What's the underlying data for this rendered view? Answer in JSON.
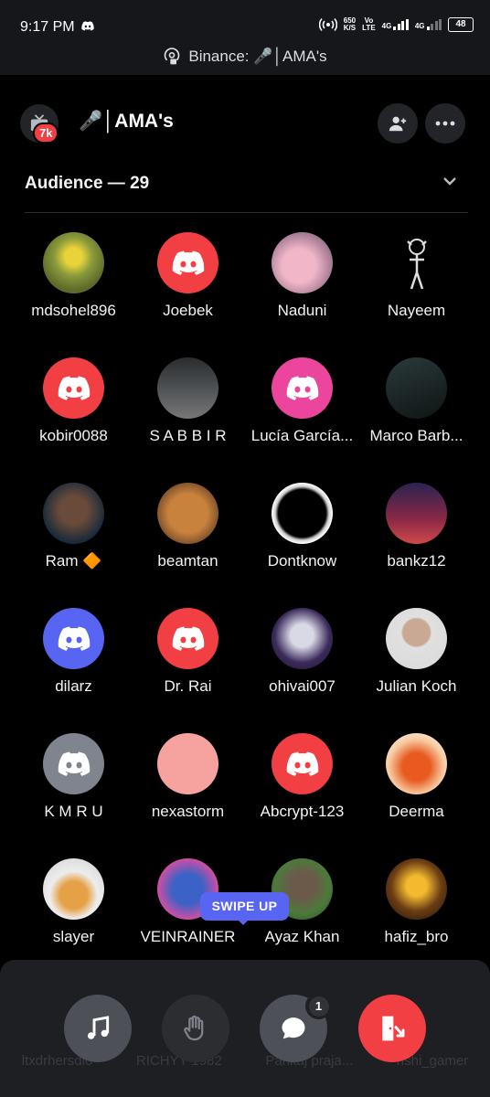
{
  "status_bar": {
    "time": "9:17 PM",
    "net_speed": "650",
    "net_unit": "K/S",
    "vo": "Vo",
    "lte": "LTE",
    "network1": "4G",
    "network2": "4G",
    "battery": "48",
    "banner_text": "Binance: 🎤│AMA's"
  },
  "header": {
    "badge": "7k",
    "title": "🎤│AMA's"
  },
  "audience": {
    "title": "Audience — 29",
    "members": [
      {
        "name": "mdsohel896",
        "avatar": "photo-flower"
      },
      {
        "name": "Joebek",
        "avatar": "discord-default-red"
      },
      {
        "name": "Naduni",
        "avatar": "photo-pink-flower"
      },
      {
        "name": "Nayeem",
        "avatar": "photo-figure"
      },
      {
        "name": "kobir0088",
        "avatar": "discord-default-red"
      },
      {
        "name": "S A B B I R",
        "avatar": "photo-crowd"
      },
      {
        "name": "Lucía García...",
        "avatar": "discord-default-pink"
      },
      {
        "name": "Marco Barb...",
        "avatar": "photo-chart"
      },
      {
        "name": "Ram 🔶",
        "avatar": "photo-man"
      },
      {
        "name": "beamtan",
        "avatar": "photo-hamster"
      },
      {
        "name": "Dontknow",
        "avatar": "photo-eclipse"
      },
      {
        "name": "bankz12",
        "avatar": "photo-car"
      },
      {
        "name": "dilarz",
        "avatar": "discord-default-blurple"
      },
      {
        "name": "Dr. Rai",
        "avatar": "discord-default-red"
      },
      {
        "name": "ohivai007",
        "avatar": "photo-anime"
      },
      {
        "name": "Julian Koch",
        "avatar": "photo-man-glasses"
      },
      {
        "name": "K M R U",
        "avatar": "discord-default-gray"
      },
      {
        "name": "nexastorm",
        "avatar": "solid-salmon"
      },
      {
        "name": "Abcrypt-123",
        "avatar": "discord-default-red"
      },
      {
        "name": "Deerma",
        "avatar": "photo-motorbike"
      },
      {
        "name": "slayer",
        "avatar": "photo-food"
      },
      {
        "name": "VEINRAINER",
        "avatar": "photo-cartoon"
      },
      {
        "name": "Ayaz Khan",
        "avatar": "photo-man-outdoor"
      },
      {
        "name": "hafiz_bro",
        "avatar": "photo-binance"
      }
    ]
  },
  "swipe_hint": "SWIPE UP",
  "hidden_row": [
    "ltxdrhersdlo",
    "RICHYY 1982",
    "Pankaj praja...",
    "rishi_gamer"
  ],
  "controls": {
    "chat_badge": "1"
  },
  "colors": {
    "discord_red": "#f23f43",
    "discord_blurple": "#5865f2",
    "discord_pink": "#eb459e",
    "discord_gray": "#80848e",
    "panel_bg": "#1e1f22"
  }
}
